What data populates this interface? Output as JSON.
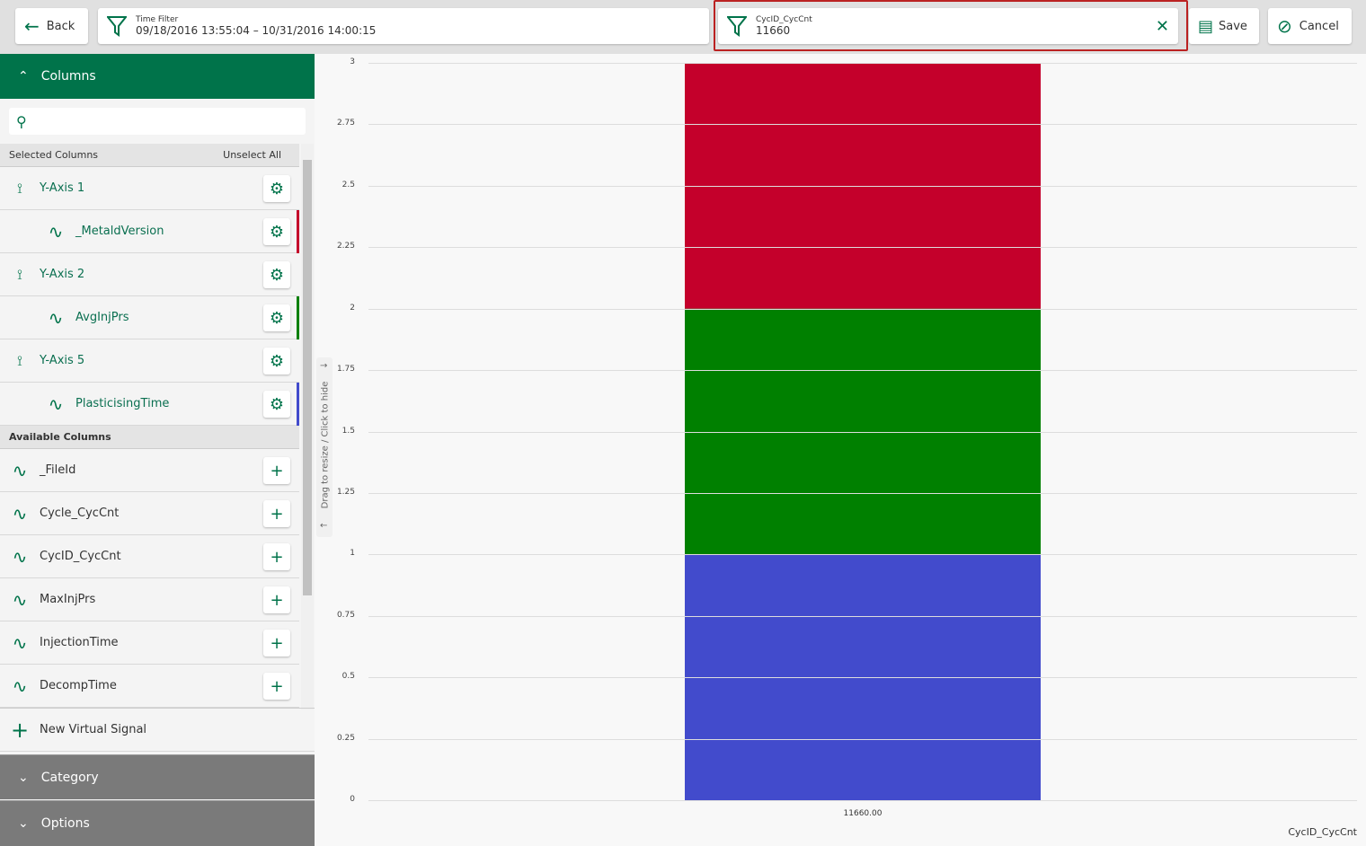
{
  "toolbar": {
    "back": "Back",
    "time_filter_label": "Time Filter",
    "time_filter_value": "09/18/2016 13:55:04 – 10/31/2016 14:00:15",
    "cyc_filter_label": "CycID_CycCnt",
    "cyc_filter_value": "11660",
    "save": "Save",
    "cancel": "Cancel"
  },
  "sidebar": {
    "columns_header": "Columns",
    "selected_header": "Selected Columns",
    "unselect_all": "Unselect All",
    "selected": [
      {
        "type": "axis",
        "label": "Y-Axis 1"
      },
      {
        "type": "signal",
        "label": "_MetaldVersion",
        "color": "#c4002b"
      },
      {
        "type": "axis",
        "label": "Y-Axis 2"
      },
      {
        "type": "signal",
        "label": "AvgInjPrs",
        "color": "#008000"
      },
      {
        "type": "axis",
        "label": "Y-Axis 5"
      },
      {
        "type": "signal",
        "label": "PlasticisingTime",
        "color": "#424bcc"
      }
    ],
    "available_header": "Available Columns",
    "available": [
      "_FileId",
      "Cycle_CycCnt",
      "CycID_CycCnt",
      "MaxInjPrs",
      "InjectionTime",
      "DecompTime"
    ],
    "new_virtual": "New Virtual Signal",
    "category": "Category",
    "options": "Options"
  },
  "drag_hint": "Drag to resize / Click to hide",
  "chart_data": {
    "type": "bar",
    "stacked": true,
    "categories": [
      "11660.00"
    ],
    "xlabel": "CycID_CycCnt",
    "ylim": [
      0,
      3
    ],
    "yticks": [
      "0",
      "0.25",
      "0.5",
      "0.75",
      "1",
      "1.25",
      "1.5",
      "1.75",
      "2",
      "2.25",
      "2.5",
      "2.75",
      "3"
    ],
    "series": [
      {
        "name": "PlasticisingTime",
        "values": [
          1
        ],
        "color": "#424bcc"
      },
      {
        "name": "AvgInjPrs",
        "values": [
          1
        ],
        "color": "#008000"
      },
      {
        "name": "_MetaldVersion",
        "values": [
          1
        ],
        "color": "#c4002b"
      }
    ]
  }
}
